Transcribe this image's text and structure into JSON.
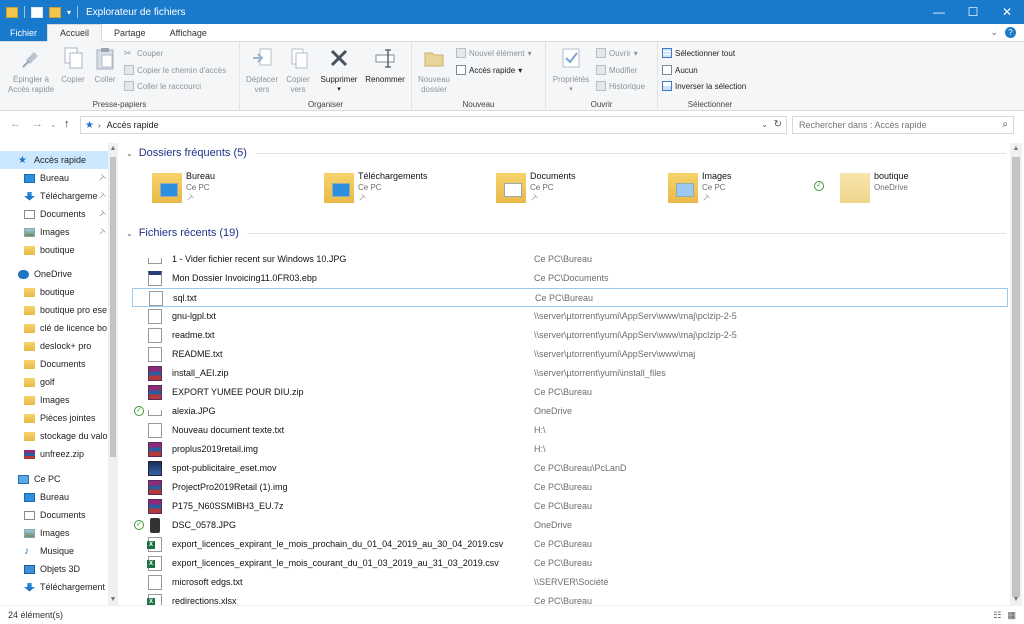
{
  "window": {
    "title": "Explorateur de fichiers",
    "controls": [
      "—",
      "☐",
      "✕"
    ]
  },
  "ribbon_tabs": [
    {
      "label": "Fichier"
    },
    {
      "label": "Accueil"
    },
    {
      "label": "Partage"
    },
    {
      "label": "Affichage"
    }
  ],
  "ribbon": {
    "presse_papiers": {
      "label": "Presse-papiers",
      "pin_l1": "Épingler à",
      "pin_l2": "Accès rapide",
      "copy": "Copier",
      "paste": "Coller",
      "cut": "Couper",
      "copy_path": "Copier le chemin d'accès",
      "paste_shortcut": "Coller le raccourci"
    },
    "organiser": {
      "label": "Organiser",
      "move_l1": "Déplacer",
      "move_l2": "vers",
      "copyto_l1": "Copier",
      "copyto_l2": "vers",
      "delete": "Supprimer",
      "rename": "Renommer"
    },
    "nouveau": {
      "label": "Nouveau",
      "new_folder_l1": "Nouveau",
      "new_folder_l2": "dossier",
      "new_item": "Nouvel élément",
      "easy_access": "Accès rapide"
    },
    "ouvrir": {
      "label": "Ouvrir",
      "properties": "Propriétés",
      "open": "Ouvrir",
      "edit": "Modifier",
      "history": "Historique"
    },
    "selectionner": {
      "label": "Sélectionner",
      "select_all": "Sélectionner tout",
      "select_none": "Aucun",
      "invert": "Inverser la sélection"
    }
  },
  "address": {
    "path": "Accès rapide",
    "search_placeholder": "Rechercher dans : Accès rapide"
  },
  "nav": [
    {
      "label": "Accès rapide",
      "icon": "star-icon",
      "selected": true
    },
    {
      "label": "Bureau",
      "icon": "desktop-icon",
      "pinned": true
    },
    {
      "label": "Téléchargeme",
      "icon": "download-icon",
      "pinned": true
    },
    {
      "label": "Documents",
      "icon": "documents-icon",
      "pinned": true
    },
    {
      "label": "Images",
      "icon": "images-icon",
      "pinned": true
    },
    {
      "label": "boutique",
      "icon": "folder-icon"
    },
    {
      "label": "OneDrive",
      "icon": "cloud-icon"
    },
    {
      "label": "boutique",
      "icon": "folder-icon"
    },
    {
      "label": "boutique pro ese",
      "icon": "folder-icon"
    },
    {
      "label": "clé de licence bo",
      "icon": "folder-icon"
    },
    {
      "label": "deslock+ pro",
      "icon": "folder-icon"
    },
    {
      "label": "Documents",
      "icon": "folder-icon"
    },
    {
      "label": "golf",
      "icon": "folder-icon"
    },
    {
      "label": "Images",
      "icon": "folder-icon"
    },
    {
      "label": "Pièces jointes",
      "icon": "folder-icon"
    },
    {
      "label": "stockage du valo",
      "icon": "folder-icon"
    },
    {
      "label": "unfreez.zip",
      "icon": "zip-icon"
    },
    {
      "label": "Ce PC",
      "icon": "computer-icon"
    },
    {
      "label": "Bureau",
      "icon": "desktop-icon"
    },
    {
      "label": "Documents",
      "icon": "documents-icon"
    },
    {
      "label": "Images",
      "icon": "images-icon"
    },
    {
      "label": "Musique",
      "icon": "music-icon"
    },
    {
      "label": "Objets 3D",
      "icon": "objects-3d-icon"
    },
    {
      "label": "Téléchargement",
      "icon": "download-icon"
    }
  ],
  "frequent": {
    "heading": "Dossiers fréquents (5)",
    "items": [
      {
        "name": "Bureau",
        "location": "Ce PC",
        "pinned": true
      },
      {
        "name": "Téléchargements",
        "location": "Ce PC",
        "pinned": true
      },
      {
        "name": "Documents",
        "location": "Ce PC",
        "pinned": true
      },
      {
        "name": "Images",
        "location": "Ce PC",
        "pinned": true
      },
      {
        "name": "boutique",
        "location": "OneDrive",
        "synced": true
      }
    ]
  },
  "recent": {
    "heading": "Fichiers récents (19)",
    "items": [
      {
        "name": "1 - Vider fichier recent sur Windows 10.JPG",
        "path": "Ce PC\\Bureau",
        "icon": "image-file-icon"
      },
      {
        "name": "Mon Dossier Invoicing11.0FR03.ebp",
        "path": "Ce PC\\Documents",
        "icon": "ebp-file-icon"
      },
      {
        "name": "sql.txt",
        "path": "Ce PC\\Bureau",
        "icon": "text-file-icon",
        "focused": true
      },
      {
        "name": "gnu-lgpl.txt",
        "path": "\\\\server\\µtorrent\\yumi\\AppServ\\www\\maj\\pclzip-2-5",
        "icon": "text-file-icon"
      },
      {
        "name": "readme.txt",
        "path": "\\\\server\\µtorrent\\yumi\\AppServ\\www\\maj\\pclzip-2-5",
        "icon": "text-file-icon"
      },
      {
        "name": "README.txt",
        "path": "\\\\server\\µtorrent\\yumi\\AppServ\\www\\maj",
        "icon": "text-file-icon"
      },
      {
        "name": "install_AEI.zip",
        "path": "\\\\server\\µtorrent\\yumi\\install_files",
        "icon": "archive-file-icon"
      },
      {
        "name": "EXPORT YUMEE POUR DIU.zip",
        "path": "Ce PC\\Bureau",
        "icon": "archive-file-icon"
      },
      {
        "name": "alexia.JPG",
        "path": "OneDrive",
        "icon": "image-file-icon",
        "synced": true
      },
      {
        "name": "Nouveau document texte.txt",
        "path": "H:\\",
        "icon": "text-file-icon"
      },
      {
        "name": "proplus2019retail.img",
        "path": "H:\\",
        "icon": "archive-file-icon"
      },
      {
        "name": "spot-publicitaire_eset.mov",
        "path": "Ce PC\\Bureau\\PcLanD",
        "icon": "video-file-icon"
      },
      {
        "name": "ProjectPro2019Retail (1).img",
        "path": "Ce PC\\Bureau",
        "icon": "archive-file-icon"
      },
      {
        "name": "P175_N60SSMIBH3_EU.7z",
        "path": "Ce PC\\Bureau",
        "icon": "archive-file-icon"
      },
      {
        "name": "DSC_0578.JPG",
        "path": "OneDrive",
        "icon": "phone-image-icon",
        "synced": true
      },
      {
        "name": "export_licences_expirant_le_mois_prochain_du_01_04_2019_au_30_04_2019.csv",
        "path": "Ce PC\\Bureau",
        "icon": "excel-file-icon"
      },
      {
        "name": "export_licences_expirant_le_mois_courant_du_01_03_2019_au_31_03_2019.csv",
        "path": "Ce PC\\Bureau",
        "icon": "excel-file-icon"
      },
      {
        "name": "microsoft edgs.txt",
        "path": "\\\\SERVER\\Société",
        "icon": "text-file-icon"
      },
      {
        "name": "redirections.xlsx",
        "path": "Ce PC\\Bureau",
        "icon": "excel-file-icon"
      }
    ]
  },
  "status": {
    "count": "24 élément(s)"
  },
  "colors": {
    "accent": "#1979ca",
    "selection": "#cce8ff",
    "heading": "#1e3287"
  }
}
